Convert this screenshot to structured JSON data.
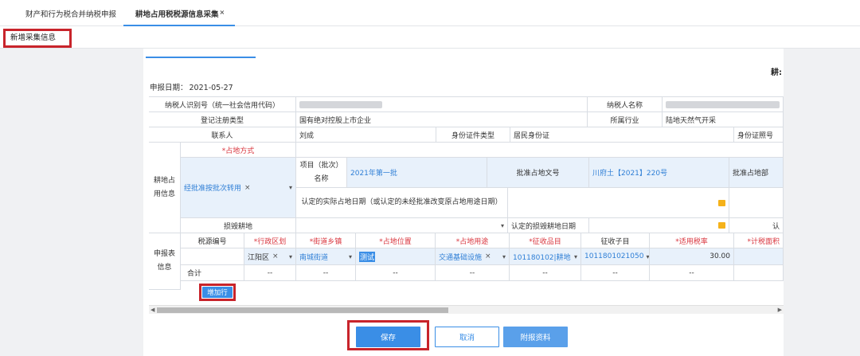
{
  "tabs": [
    {
      "label": "财产和行为税合并纳税申报"
    },
    {
      "label": "耕地占用税税源信息采集",
      "close": "×"
    }
  ],
  "toolbar": {
    "new_label": "新增采集信息"
  },
  "form": {
    "title_fragment": "耕:",
    "decl_date_label": "申报日期：",
    "decl_date": "2021-05-27",
    "taxpayer_id_label": "纳税人识别号（统一社会信用代码）",
    "taxpayer_name_label": "纳税人名称",
    "reg_type_label": "登记注册类型",
    "reg_type": "国有绝对控股上市企业",
    "industry_label": "所属行业",
    "industry": "陆地天然气开采",
    "contact_label": "联系人",
    "contact": "刘成",
    "id_type_label": "身份证件类型",
    "id_type": "居民身份证",
    "id_no_label": "身份证照号",
    "occupy_section_label": "耕地占用信息",
    "occupy_method_label": "*占地方式",
    "occupy_method_value": "经批准按批次转用",
    "project_name_label": "项目（批次）名称",
    "project_name": "2021年第一批",
    "approval_doc_label": "批准占地文号",
    "approval_doc": "川府土【2021】220号",
    "approval_dept_label": "批准占地部",
    "actual_date_label": "认定的实际占地日期（或认定的未经批准改变原占地用途日期）",
    "damage_label": "损毁耕地",
    "damage_date_label": "认定的损毁耕地日期",
    "damage_tail_label": "认",
    "report_section_label": "申报表信息",
    "headers": [
      "税源编号",
      "*行政区划",
      "*街道乡镇",
      "*占地位置",
      "*占地用途",
      "*征收品目",
      "征收子目",
      "*适用税率",
      "*计税面积"
    ],
    "row": {
      "district": "江阳区",
      "street": "南城街道",
      "location": "测试",
      "usage": "交通基础设施",
      "item": "101180102|耕地",
      "subitem": "1011801021050",
      "rate": "30.00"
    },
    "total_label": "合计",
    "add_row_label": "增加行",
    "dash": "--"
  },
  "buttons": {
    "save": "保存",
    "cancel": "取消",
    "attach": "附报资料"
  }
}
